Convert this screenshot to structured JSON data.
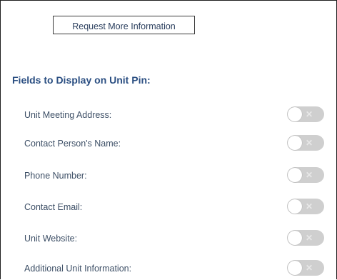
{
  "request_button": {
    "label": "Request More Information"
  },
  "section": {
    "title": "Fields to Display on Unit Pin:"
  },
  "fields": [
    {
      "label": "Unit Meeting Address:",
      "enabled": false
    },
    {
      "label": "Contact Person's Name:",
      "enabled": false
    },
    {
      "label": "Phone Number:",
      "enabled": false
    },
    {
      "label": "Contact Email:",
      "enabled": false
    },
    {
      "label": "Unit Website:",
      "enabled": false
    },
    {
      "label": "Additional Unit Information:",
      "enabled": false
    }
  ],
  "toggle": {
    "off_symbol": "✕",
    "off_color": "#cfcfcf"
  }
}
